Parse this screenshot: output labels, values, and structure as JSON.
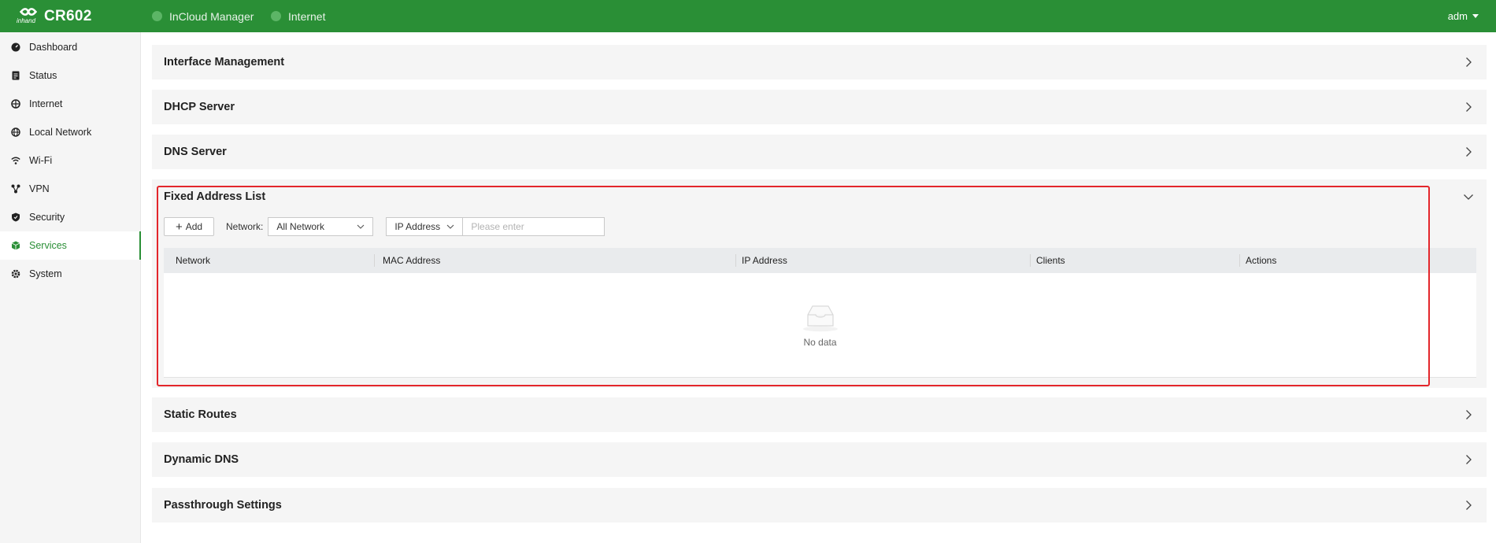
{
  "app": {
    "logo_text": "CR602",
    "logo_sub": "inhand",
    "links": [
      {
        "label": "InCloud Manager"
      },
      {
        "label": "Internet"
      }
    ],
    "user": "adm"
  },
  "sidebar": {
    "items": [
      {
        "label": "Dashboard",
        "icon": "dashboard-icon"
      },
      {
        "label": "Status",
        "icon": "status-icon"
      },
      {
        "label": "Internet",
        "icon": "internet-icon"
      },
      {
        "label": "Local Network",
        "icon": "globe-icon"
      },
      {
        "label": "Wi-Fi",
        "icon": "wifi-icon"
      },
      {
        "label": "VPN",
        "icon": "vpn-icon"
      },
      {
        "label": "Security",
        "icon": "shield-icon"
      },
      {
        "label": "Services",
        "icon": "cube-icon",
        "active": true
      },
      {
        "label": "System",
        "icon": "gear-icon"
      }
    ]
  },
  "panels": {
    "interface_management": "Interface Management",
    "dhcp_server": "DHCP Server",
    "dns_server": "DNS Server",
    "fixed_address_list": "Fixed Address List",
    "static_routes": "Static Routes",
    "dynamic_dns": "Dynamic DNS",
    "passthrough_settings": "Passthrough Settings"
  },
  "fixed": {
    "add_label": "Add",
    "network_label": "Network:",
    "network_value": "All Network",
    "search_field": "IP Address",
    "search_placeholder": "Please enter",
    "columns": [
      "Network",
      "MAC Address",
      "IP Address",
      "Clients",
      "Actions"
    ],
    "empty_text": "No data"
  },
  "colors": {
    "brand": "#2a8f36",
    "highlight": "#e3262b"
  }
}
